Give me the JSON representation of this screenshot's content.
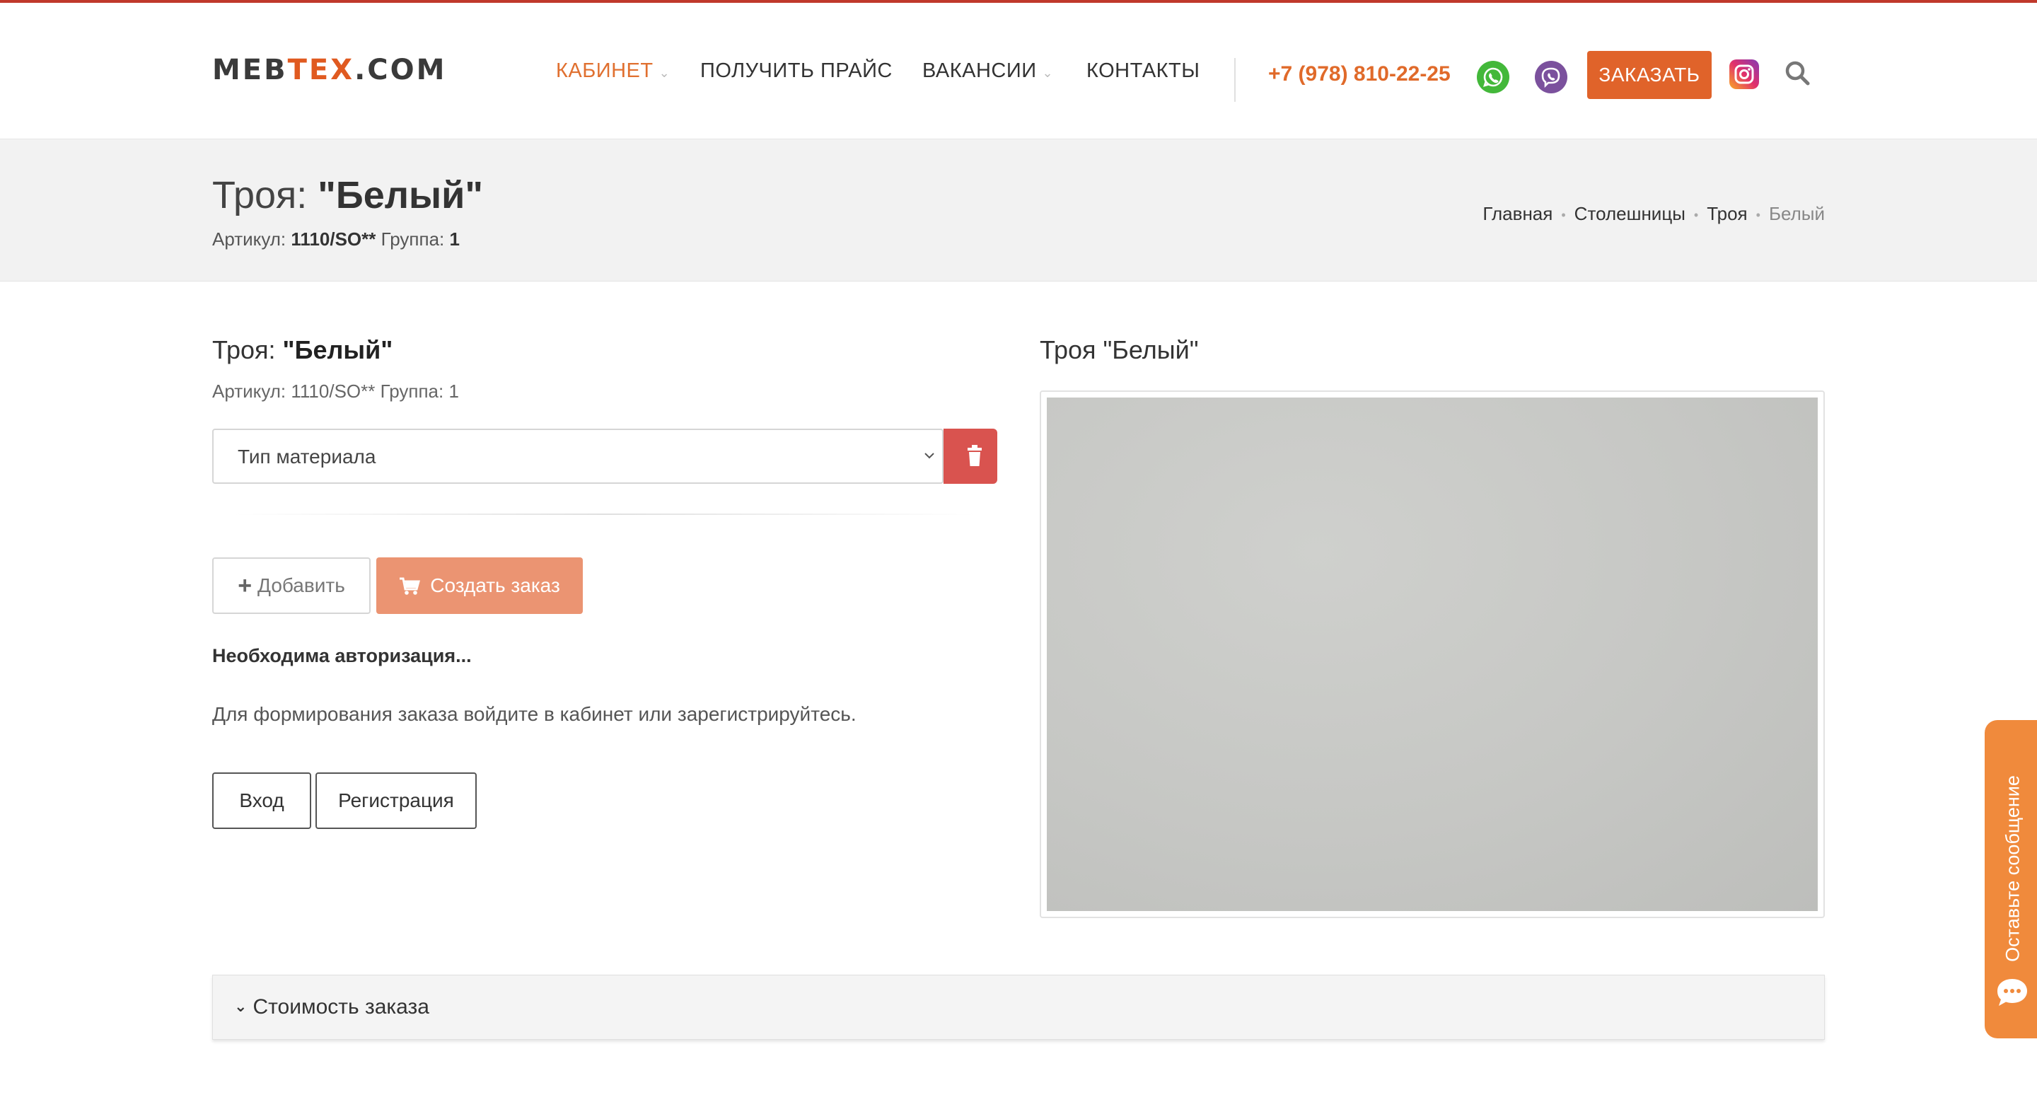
{
  "header": {
    "logo_pre": "MEB",
    "logo_accent": "TEX",
    "logo_post": ".COM",
    "nav": [
      {
        "label": "КАБИНЕТ",
        "active": true,
        "has_dropdown": true
      },
      {
        "label": "ПОЛУЧИТЬ ПРАЙС",
        "active": false,
        "has_dropdown": false
      },
      {
        "label": "ВАКАНСИИ",
        "active": false,
        "has_dropdown": true
      },
      {
        "label": "КОНТАКТЫ",
        "active": false,
        "has_dropdown": false
      }
    ],
    "phone": "+7 (978) 810-22-25",
    "order_button": "ЗАКАЗАТЬ",
    "icons": [
      "whatsapp-icon",
      "viber-icon",
      "instagram-icon",
      "search-icon"
    ],
    "accent_color": "#e0632a"
  },
  "page_header": {
    "title_prefix": "Троя:",
    "title_name": "\"Белый\"",
    "article_label": "Артикул:",
    "article_value": "1110/SO**",
    "group_label": "Группа:",
    "group_value": "1"
  },
  "breadcrumb": [
    "Главная",
    "Столешницы",
    "Троя",
    "Белый"
  ],
  "product": {
    "title_prefix": "Троя:",
    "title_name": "\"Белый\"",
    "meta": "Артикул: 1110/SO** Группа: 1",
    "material_select": {
      "selected": "Тип материала"
    },
    "add_button": "Добавить",
    "create_order_button": "Создать заказ",
    "auth_title": "Необходима авторизация...",
    "auth_text": "Для формирования заказа войдите в кабинет или зарегистрируйтесь.",
    "login_button": "Вход",
    "register_button": "Регистрация"
  },
  "image_panel": {
    "title": "Троя \"Белый\""
  },
  "order_cost": {
    "title": "Стоимость заказа"
  },
  "side_tab": {
    "label": "Оставьте сообщение"
  }
}
